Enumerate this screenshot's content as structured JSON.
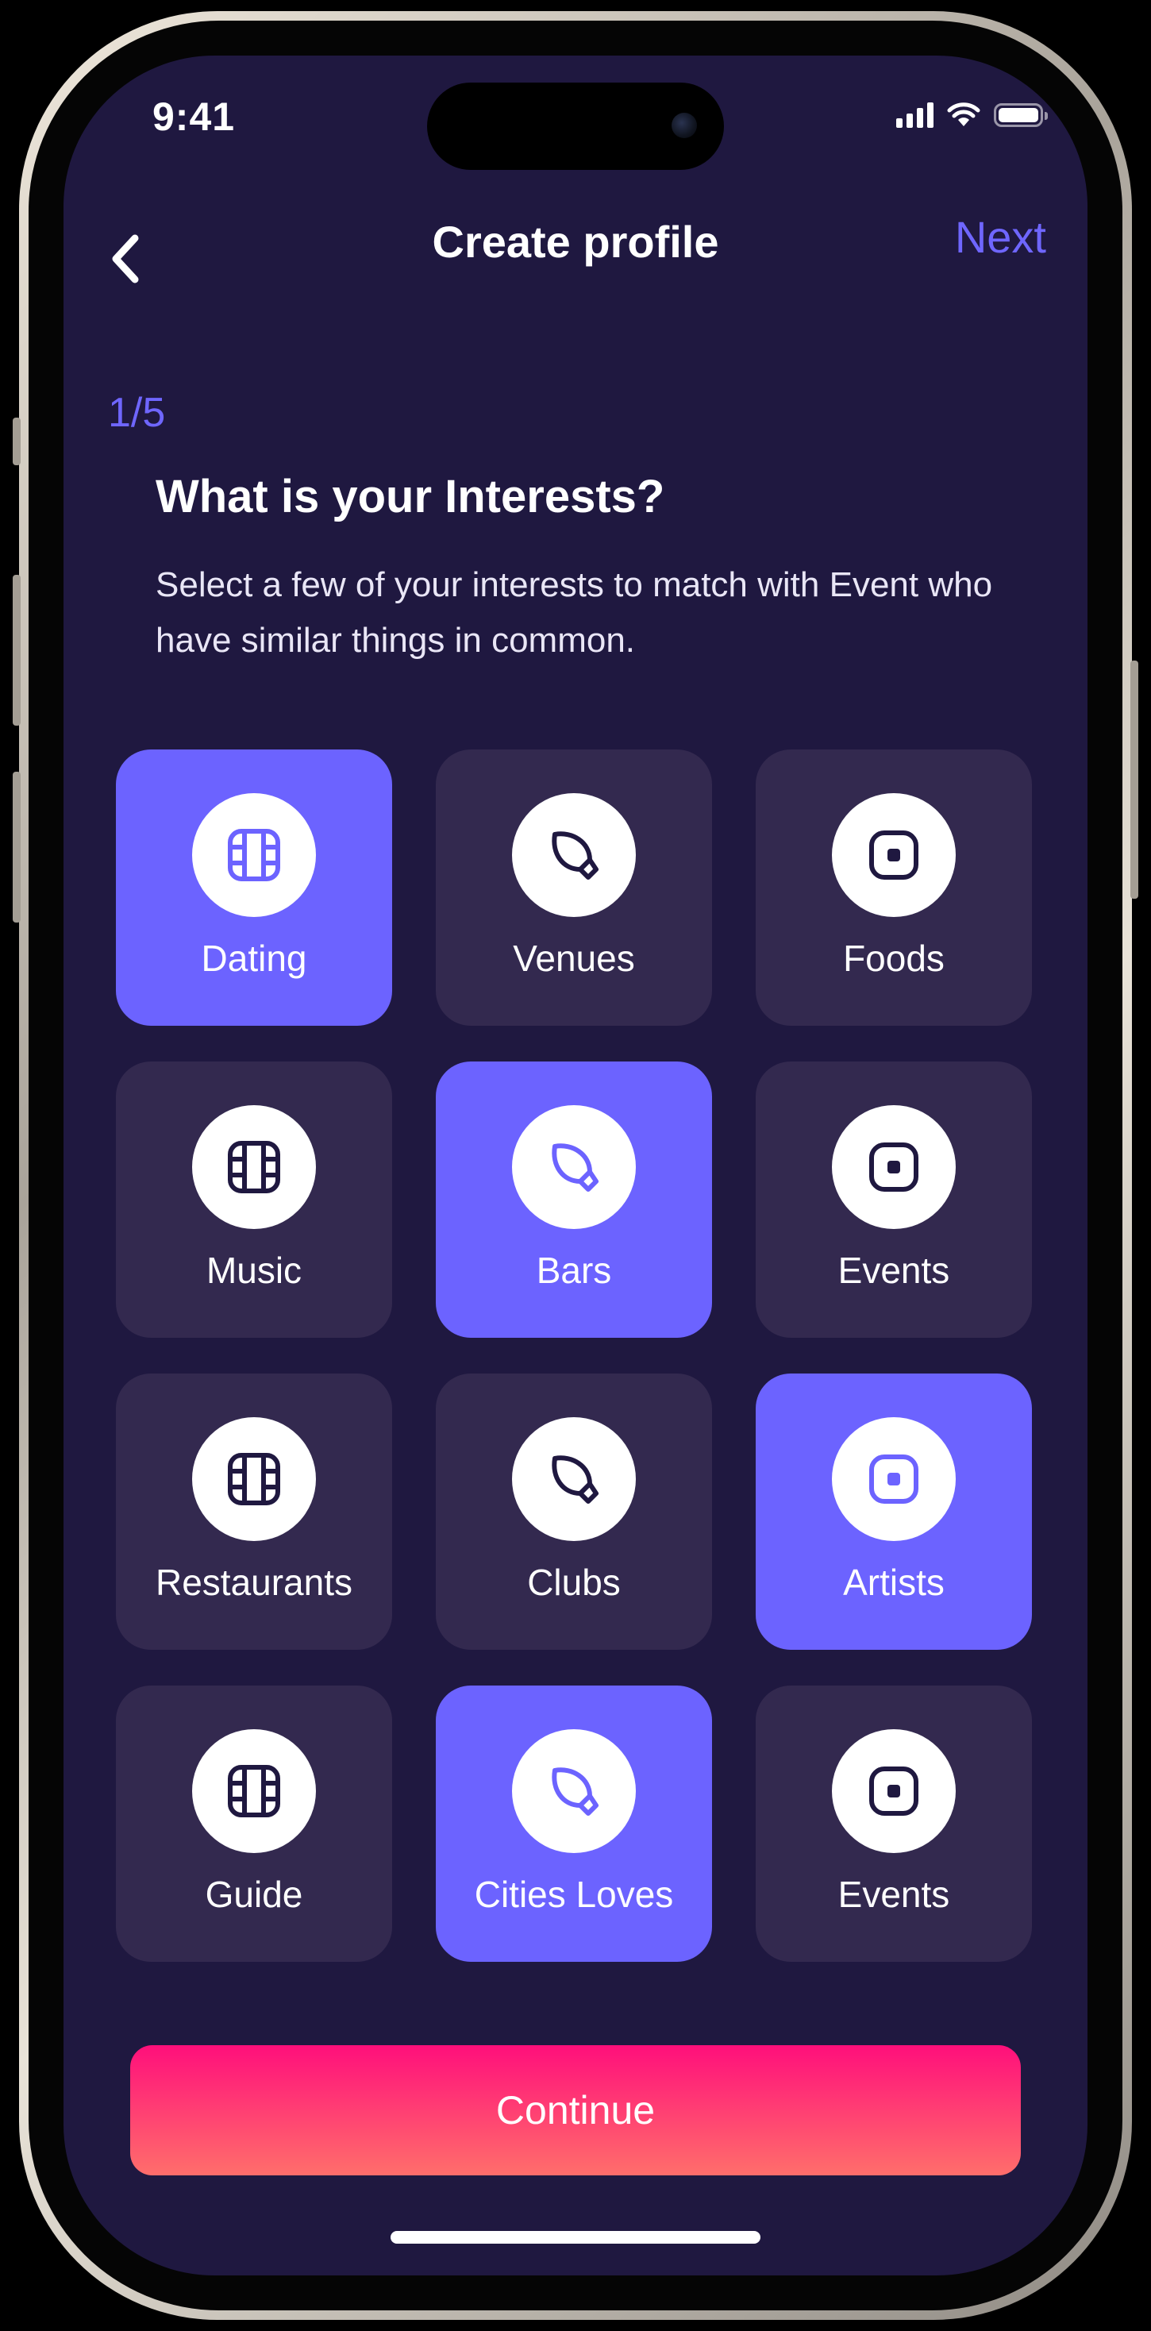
{
  "status_bar": {
    "time": "9:41"
  },
  "header": {
    "title": "Create profile",
    "next_label": "Next"
  },
  "step": "1/5",
  "question": "What is your Interests?",
  "description": "Select a few of your interests to match with Event who have similar things in common.",
  "interests": [
    {
      "label": "Dating",
      "icon": "film-icon",
      "selected": true
    },
    {
      "label": "Venues",
      "icon": "leaf-icon",
      "selected": false
    },
    {
      "label": "Foods",
      "icon": "square-dot-icon",
      "selected": false
    },
    {
      "label": "Music",
      "icon": "film-icon",
      "selected": false
    },
    {
      "label": "Bars",
      "icon": "leaf-icon",
      "selected": true
    },
    {
      "label": "Events",
      "icon": "square-dot-icon",
      "selected": false
    },
    {
      "label": "Restaurants",
      "icon": "film-icon",
      "selected": false
    },
    {
      "label": "Clubs",
      "icon": "leaf-icon",
      "selected": false
    },
    {
      "label": "Artists",
      "icon": "square-dot-icon",
      "selected": true
    },
    {
      "label": "Guide",
      "icon": "film-icon",
      "selected": false
    },
    {
      "label": "Cities Loves",
      "icon": "leaf-icon",
      "selected": true
    },
    {
      "label": "Events",
      "icon": "square-dot-icon",
      "selected": false
    }
  ],
  "continue_label": "Continue",
  "colors": {
    "background": "#1f1840",
    "tile": "#33294f",
    "accent": "#6c63ff",
    "icon_dark": "#1f1840",
    "button_gradient_top": "#ff0f7b",
    "button_gradient_bottom": "#ff6e6b"
  }
}
